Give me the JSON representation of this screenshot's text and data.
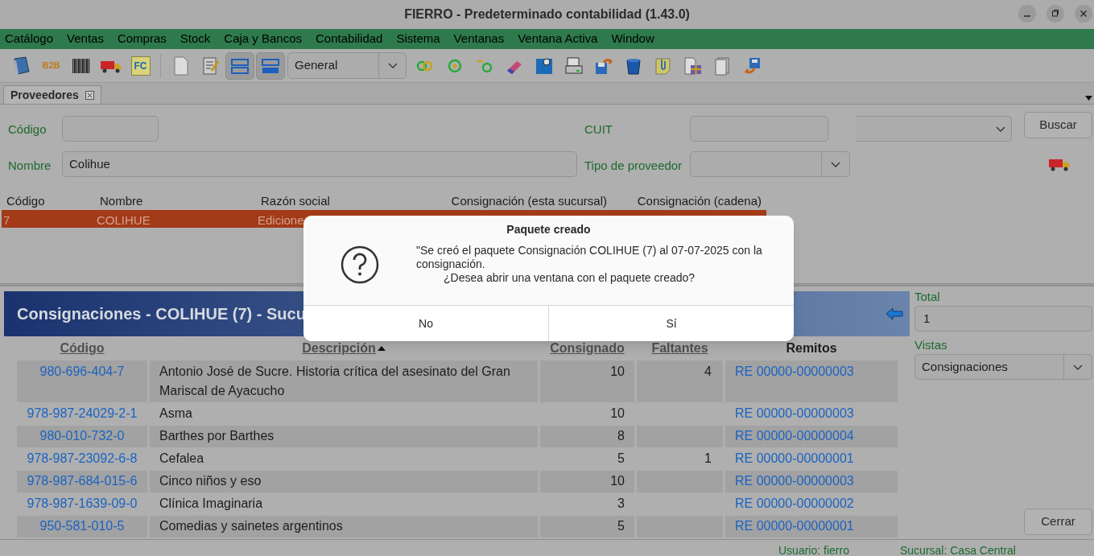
{
  "window": {
    "title": "FIERRO - Predeterminado contabilidad (1.43.0)"
  },
  "menu": [
    "Catálogo",
    "Ventas",
    "Compras",
    "Stock",
    "Caja y Bancos",
    "Contabilidad",
    "Sistema",
    "Ventanas",
    "Ventana Activa",
    "Window"
  ],
  "toolbar": {
    "labels": [
      "B2B",
      "FC"
    ],
    "toggles": [
      {
        "selected": true
      },
      {
        "selected": true
      }
    ],
    "view_combo": {
      "value": "General"
    }
  },
  "tabs": [
    {
      "label": "Proveedores",
      "selected": true
    }
  ],
  "search_form": {
    "codigo_label": "Código",
    "cuit_label": "CUIT",
    "nombre_label": "Nombre",
    "nombre_value": "Colihue",
    "tipo_label": "Tipo de proveedor",
    "search_button": "Buscar"
  },
  "providers_table": {
    "columns": [
      "Código",
      "Nombre",
      "Razón social",
      "Consignación (esta sucursal)",
      "Consignación (cadena)"
    ],
    "rows": [
      {
        "cells": [
          "7",
          "COLIHUE",
          "Edicione"
        ],
        "selected": true
      }
    ]
  },
  "consignments": {
    "title": "Consignaciones - COLIHUE (7) - Sucu",
    "columns": [
      {
        "label": "Código",
        "sortable": true,
        "sorted": false
      },
      {
        "label": "Descripción",
        "sortable": true,
        "sorted": true
      },
      {
        "label": "Consignado",
        "sortable": true,
        "sorted": false
      },
      {
        "label": "Faltantes",
        "sortable": true,
        "sorted": false
      },
      {
        "label": "Remitos",
        "sortable": false,
        "sorted": false
      }
    ],
    "rows": [
      {
        "codigo": "980-696-404-7",
        "descripcion": "Antonio José de Sucre. Historia crítica del asesinato del Gran Mariscal de Ayacucho",
        "consignado": "10",
        "faltantes": "4",
        "remito": "RE 00000-00000003"
      },
      {
        "codigo": "978-987-24029-2-1",
        "descripcion": "Asma",
        "consignado": "10",
        "remito": "RE 00000-00000003"
      },
      {
        "codigo": "980-010-732-0",
        "descripcion": "Barthes por Barthes",
        "consignado": "8",
        "remito": "RE 00000-00000004"
      },
      {
        "codigo": "978-987-23092-6-8",
        "descripcion": "Cefalea",
        "consignado": "5",
        "faltantes": "1",
        "remito": "RE 00000-00000001"
      },
      {
        "codigo": "978-987-684-015-6",
        "descripcion": "Cinco niños y eso",
        "consignado": "10",
        "remito": "RE 00000-00000003"
      },
      {
        "codigo": "978-987-1639-09-0",
        "descripcion": "Clínica Imaginaria",
        "consignado": "3",
        "remito": "RE 00000-00000002"
      },
      {
        "codigo": "950-581-010-5",
        "descripcion": "Comedias y sainetes argentinos",
        "consignado": "5",
        "remito": "RE 00000-00000001"
      }
    ]
  },
  "side_panel": {
    "total_label": "Total",
    "total_value": "1",
    "vistas_label": "Vistas",
    "vistas_value": "Consignaciones",
    "close_button": "Cerrar"
  },
  "status_bar": {
    "user": "Usuario: fierro",
    "branch": "Sucursal: Casa Central"
  },
  "dialog": {
    "title": "Paquete creado",
    "message": "\"Se creó el paquete Consignación COLIHUE (7) al 07-07-2025 con la consignación.",
    "question": "¿Desea abrir una ventana con el paquete creado?",
    "buttons": [
      "No",
      "Sí"
    ]
  }
}
